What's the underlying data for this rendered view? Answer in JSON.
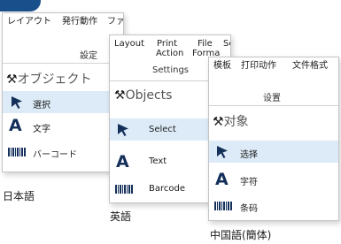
{
  "colors": {
    "accent": "#19508c",
    "selection": "#dcebf7",
    "icon": "#14305a"
  },
  "panels": {
    "ja": {
      "menu": [
        "レイアウト",
        "発行動作",
        "ファイル形"
      ],
      "submenu": "設定",
      "header": "オブジェクト",
      "items": [
        {
          "icon": "cursor-arrow-icon",
          "label": "選択",
          "selected": true
        },
        {
          "icon": "text-a-icon",
          "label": "文字",
          "selected": false
        },
        {
          "icon": "barcode-icon",
          "label": "バーコード",
          "selected": false
        }
      ],
      "caption": "日本語"
    },
    "en": {
      "menu": [
        "Layout",
        "Print",
        "File",
        "Se"
      ],
      "menu_line2": [
        "Action",
        "Forma"
      ],
      "submenu": "Settings",
      "header": "Objects",
      "items": [
        {
          "icon": "cursor-arrow-icon",
          "label": "Select",
          "selected": true
        },
        {
          "icon": "text-a-icon",
          "label": "Text",
          "selected": false
        },
        {
          "icon": "barcode-icon",
          "label": "Barcode",
          "selected": false
        }
      ],
      "caption": "英語"
    },
    "zh": {
      "menu": [
        "模板",
        "打印动作",
        "文件格式"
      ],
      "submenu": "设置",
      "header": "对象",
      "items": [
        {
          "icon": "cursor-arrow-icon",
          "label": "选择",
          "selected": true
        },
        {
          "icon": "text-a-icon",
          "label": "字符",
          "selected": false
        },
        {
          "icon": "barcode-icon",
          "label": "条码",
          "selected": false
        }
      ],
      "caption": "中国語(簡体)"
    }
  }
}
